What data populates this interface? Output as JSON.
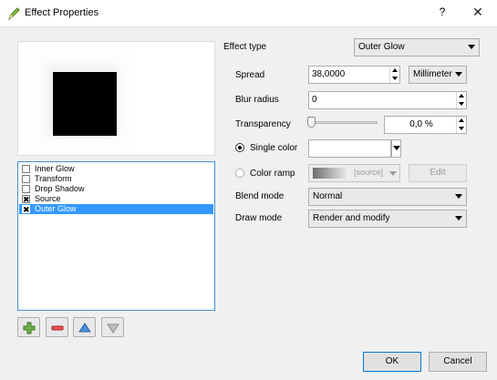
{
  "window": {
    "title": "Effect Properties",
    "help": "?",
    "close": "✕"
  },
  "layers": [
    {
      "label": "Inner Glow",
      "checked": false,
      "selected": false
    },
    {
      "label": "Transform",
      "checked": false,
      "selected": false
    },
    {
      "label": "Drop Shadow",
      "checked": false,
      "selected": false
    },
    {
      "label": "Source",
      "checked": true,
      "selected": false
    },
    {
      "label": "Outer Glow",
      "checked": true,
      "selected": true
    }
  ],
  "layer_tools": {
    "add": "add-effect-icon",
    "remove": "remove-effect-icon",
    "up": "move-up-icon",
    "down": "move-down-icon"
  },
  "effect_type": {
    "label": "Effect type",
    "value": "Outer Glow"
  },
  "spread": {
    "label": "Spread",
    "value": "38,0000",
    "unit": "Millimeter"
  },
  "blur": {
    "label": "Blur radius",
    "value": "0"
  },
  "transparency": {
    "label": "Transparency",
    "value": "0,0 %",
    "level": 0
  },
  "color_mode": {
    "single_label": "Single color",
    "single_selected": true,
    "single_color": "#ffffff",
    "ramp_label": "Color ramp",
    "ramp_value": "[source]",
    "edit_label": "Edit"
  },
  "blend_mode": {
    "label": "Blend mode",
    "value": "Normal"
  },
  "draw_mode": {
    "label": "Draw mode",
    "value": "Render and modify"
  },
  "buttons": {
    "ok": "OK",
    "cancel": "Cancel"
  }
}
